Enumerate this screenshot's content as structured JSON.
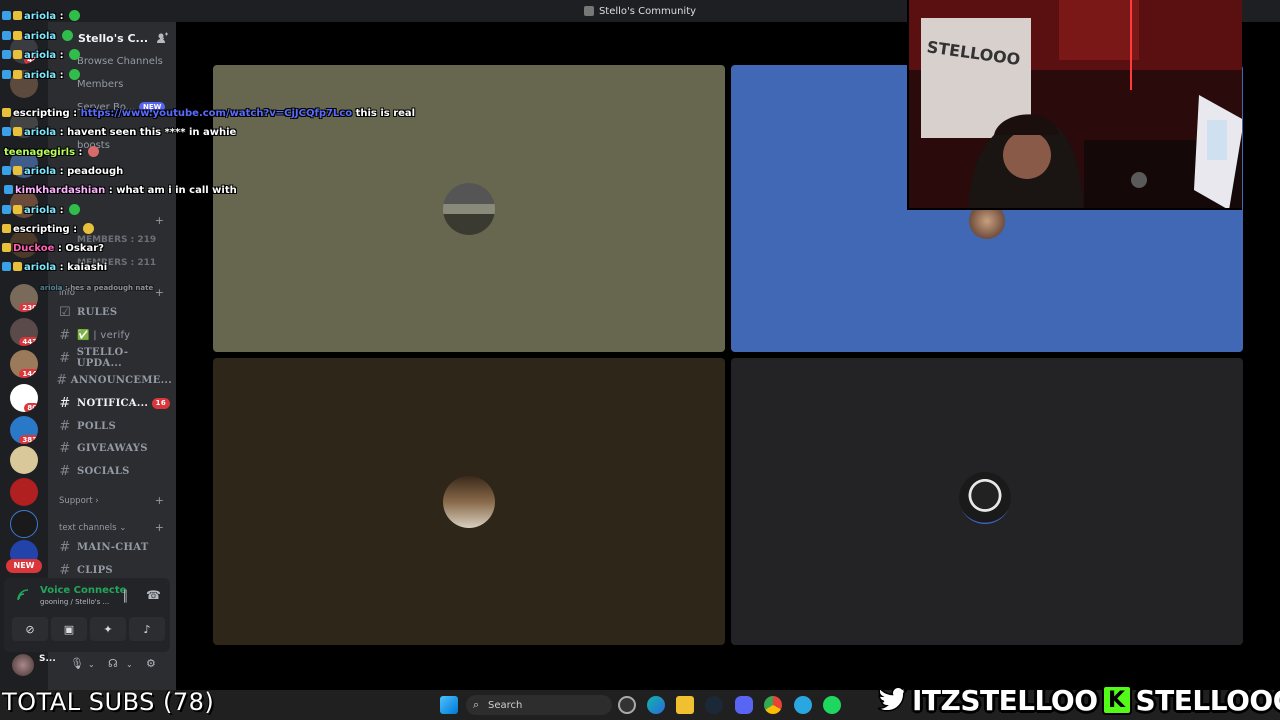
{
  "window": {
    "title": "Stello's Community"
  },
  "server": {
    "name": "Stello's C...",
    "nav": [
      "Browse Channels",
      "Members",
      "Server Bo...",
      "boosts"
    ],
    "new_tag": "NEW",
    "stats": [
      "MEMBERS : 219",
      "MEMBERS : 211"
    ],
    "info_label": "info",
    "categories": {
      "support": "Support",
      "text": "text channels"
    },
    "channels_info": [
      {
        "name": "RULES",
        "unread": false
      },
      {
        "name": "✅ | verify",
        "unread": false
      },
      {
        "name": "STELLO-UPDA...",
        "unread": false
      },
      {
        "name": "ANNOUNCEME...",
        "unread": false
      },
      {
        "name": "NOTIFICA...",
        "unread": true,
        "count": "16"
      },
      {
        "name": "POLLS",
        "unread": false
      },
      {
        "name": "GIVEAWAYS",
        "unread": false
      },
      {
        "name": "SOCIALS",
        "unread": false
      }
    ],
    "channels_text": [
      {
        "name": "MAIN-CHAT"
      },
      {
        "name": "CLIPS"
      }
    ]
  },
  "guild_badges": [
    "48",
    "230",
    "443",
    "144",
    "80",
    "383"
  ],
  "guild_new": "NEW",
  "voice": {
    "status": "Voice Connecte",
    "channel": "gooning / Stello's ..."
  },
  "user": {
    "name": "S..."
  },
  "chat_overlay": [
    {
      "user": "ariola",
      "color": "#7ee8ff",
      "text": ""
    },
    {
      "user": "ariola",
      "color": "#7ee8ff",
      "text": ""
    },
    {
      "user": "ariola",
      "color": "#7ee8ff",
      "text": ""
    },
    {
      "user": "ariola",
      "color": "#7ee8ff",
      "text": ""
    },
    {
      "user": "escripting",
      "color": "#ffffff",
      "link": "https://www.youtube.com/watch?v=CjJCQfp7Lco",
      "text": "this is real"
    },
    {
      "user": "ariola",
      "color": "#7ee8ff",
      "text": "havent seen this **** in awhie"
    },
    {
      "user": "teenagegirls",
      "color": "#b8ff5a",
      "text": ""
    },
    {
      "user": "ariola",
      "color": "#7ee8ff",
      "text": "peadough"
    },
    {
      "user": "kimkhardashian",
      "color": "#ffb3ff",
      "text": "what am i in call with"
    },
    {
      "user": "ariola",
      "color": "#7ee8ff",
      "text": ""
    },
    {
      "user": "escripting",
      "color": "#ffffff",
      "text": ""
    },
    {
      "user": "Duckoe",
      "color": "#ff5fb6",
      "text": "Oskar?"
    },
    {
      "user": "ariola",
      "color": "#7ee8ff",
      "text": "kaiashi"
    },
    {
      "user": "ariola",
      "color": "#7ee8ff",
      "text": "hes a peadough nate",
      "faded": true
    }
  ],
  "taskbar": {
    "search_placeholder": "Search"
  },
  "overlay": {
    "total_subs": "TOTAL SUBS (78)",
    "twitter_handle": "ITZSTELLOO",
    "kick_handle": "STELLOOO",
    "webcam_sign": "STELLOOO"
  },
  "colors": {
    "tile1": "#67674f",
    "tile2": "#4068b4",
    "tile3": "#2e2619",
    "tile4": "#232326",
    "accent": "#5865f2",
    "voice_green": "#23a55a",
    "kick_green": "#53fc18",
    "twitter_blue": "#1d9bf0"
  }
}
